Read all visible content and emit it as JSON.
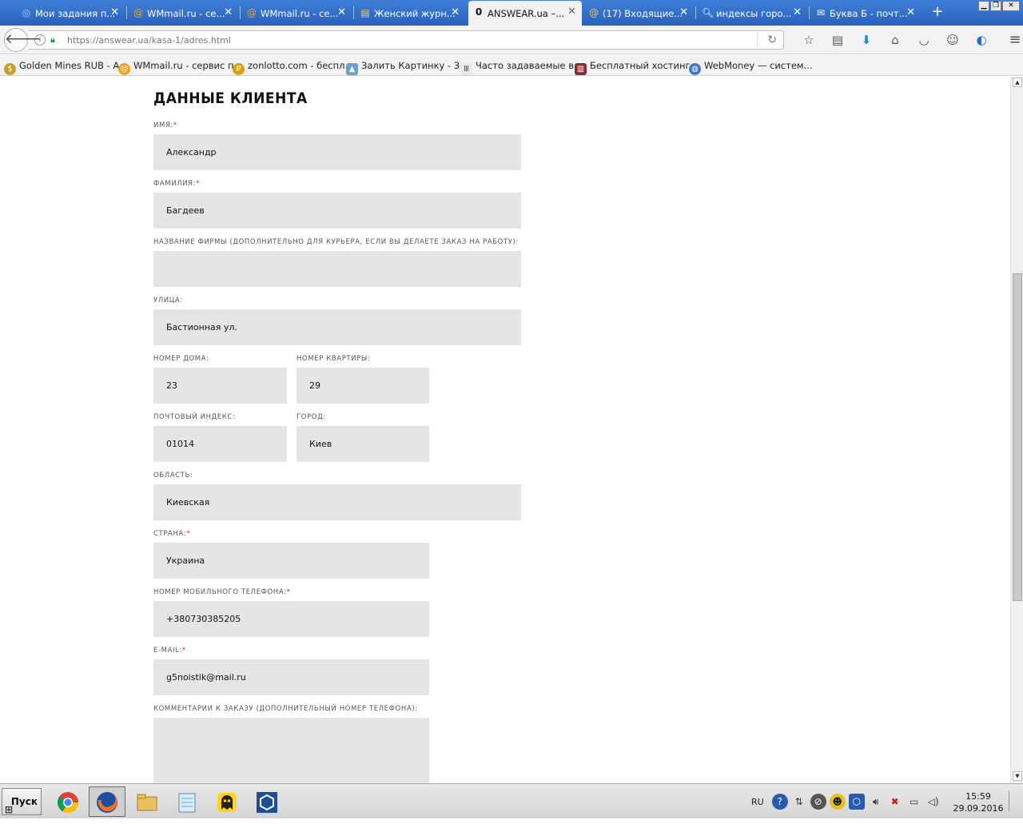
{
  "browser": {
    "tabs": [
      {
        "label": "Мои задания п...",
        "icon": "blue-swirl-icon"
      },
      {
        "label": "WMmail.ru - се...",
        "icon": "at-sign-icon"
      },
      {
        "label": "WMmail.ru - се...",
        "icon": "at-sign-icon"
      },
      {
        "label": "Женский журн...",
        "icon": "magazine-icon"
      },
      {
        "label": "ANSWEAR.ua –...",
        "icon": "answear-logo-icon",
        "active": true
      },
      {
        "label": "(17) Входящие...",
        "icon": "mail-at-icon"
      },
      {
        "label": "индексы горо...",
        "icon": "search-icon"
      },
      {
        "label": "Буква Б - почт...",
        "icon": "envelope-icon"
      }
    ],
    "new_tab_symbol": "+",
    "url": "https://answear.ua/kasa-1/adres.html",
    "url_domain": "answear.ua",
    "bookmarks": [
      {
        "label": "Golden Mines RUB - A...",
        "icon": "dollar-coin-icon"
      },
      {
        "label": "WMmail.ru - сервис п...",
        "icon": "at-sign-icon"
      },
      {
        "label": "zonlotto.com - беспл...",
        "icon": "ruble-coin-icon"
      },
      {
        "label": "Залить Картинку - З...",
        "icon": "image-upload-icon"
      },
      {
        "label": "Часто задаваемые в...",
        "icon": "column-icon"
      },
      {
        "label": "Бесплатный хостинг...",
        "icon": "books-icon"
      },
      {
        "label": "WebMoney — систем...",
        "icon": "globe-icon"
      }
    ]
  },
  "form": {
    "title": "ДАННЫЕ КЛИЕНТА",
    "required_mark": "*",
    "fields": {
      "first_name": {
        "label": "ИМЯ:",
        "value": "Александр",
        "required": true
      },
      "last_name": {
        "label": "ФАМИЛИЯ:",
        "value": "Багдеев",
        "required": true
      },
      "company": {
        "label": "НАЗВАНИЕ ФИРМЫ (ДОПОЛНИТЕЛЬНО ДЛЯ КУРЬЕРА, ЕСЛИ ВЫ ДЕЛАЕТЕ ЗАКАЗ НА РАБОТУ):",
        "value": ""
      },
      "street": {
        "label": "УЛИЦА:",
        "value": "Бастионная ул."
      },
      "house": {
        "label": "НОМЕР ДОМА:",
        "value": "23"
      },
      "apartment": {
        "label": "НОМЕР КВАРТИРЫ:",
        "value": "29"
      },
      "postcode": {
        "label": "ПОЧТОВЫЙ ИНДЕКС:",
        "value": "01014"
      },
      "city": {
        "label": "ГОРОД:",
        "value": "Киев"
      },
      "region": {
        "label": "ОБЛАСТЬ:",
        "value": "Киевская"
      },
      "country": {
        "label": "СТРАНА:",
        "value": "Украина",
        "required": true
      },
      "phone": {
        "label": "НОМЕР МОБИЛЬНОГО ТЕЛЕФОНА:",
        "value": "+380730385205",
        "required": true
      },
      "email": {
        "label": "E-MAIL:",
        "value": "g5noistik@mail.ru",
        "required": true
      },
      "comments": {
        "label": "КОММЕНТАРИИ К ЗАКАЗУ (ДОПОЛНИТЕЛЬНЫЙ НОМЕР ТЕЛЕФОНА):",
        "value": ""
      }
    }
  },
  "taskbar": {
    "start_label": "Пуск",
    "apps": [
      "chrome-icon",
      "firefox-icon",
      "folder-icon",
      "notepad-icon",
      "ghost-app-icon",
      "hexagon-app-icon"
    ],
    "language": "RU",
    "time": "15:59",
    "date": "29.09.2016"
  }
}
